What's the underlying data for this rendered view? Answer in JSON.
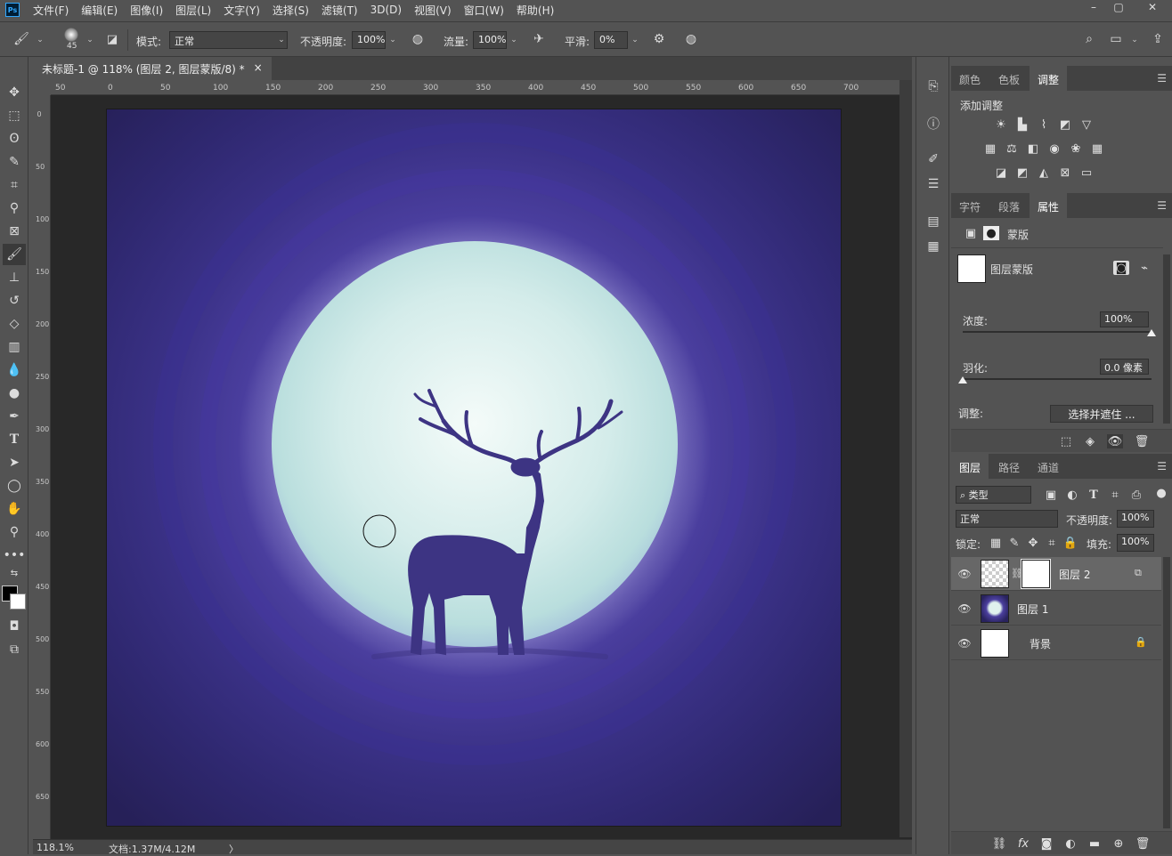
{
  "app": {
    "logo": "Ps"
  },
  "menu": [
    "文件(F)",
    "编辑(E)",
    "图像(I)",
    "图层(L)",
    "文字(Y)",
    "选择(S)",
    "滤镜(T)",
    "3D(D)",
    "视图(V)",
    "窗口(W)",
    "帮助(H)"
  ],
  "window_controls": {
    "minimize": "–",
    "restore": "▢",
    "close": "✕"
  },
  "options": {
    "brush_size": "45",
    "mode_label": "模式:",
    "mode_value": "正常",
    "opacity_label": "不透明度:",
    "opacity_value": "100%",
    "flow_label": "流量:",
    "flow_value": "100%",
    "smoothing_label": "平滑:",
    "smoothing_value": "0%"
  },
  "document": {
    "tab_title": "未标题-1 @ 118% (图层 2, 图层蒙版/8) *",
    "tab_close": "×",
    "ruler_h": [
      "50",
      "0",
      "50",
      "100",
      "150",
      "200",
      "250",
      "300",
      "350",
      "400",
      "450",
      "500",
      "550",
      "600",
      "650",
      "700"
    ],
    "ruler_v": [
      "0",
      "50",
      "100",
      "150",
      "200",
      "250",
      "300",
      "350",
      "400",
      "450",
      "500",
      "550",
      "600",
      "650"
    ]
  },
  "status": {
    "zoom": "118.1%",
    "doc_info": "文档:1.37M/4.12M",
    "arrow": "〉"
  },
  "panels": {
    "color_tabs": [
      "颜色",
      "色板",
      "调整"
    ],
    "color_active": 2,
    "add_adjustment": "添加调整",
    "props_tabs": [
      "字符",
      "段落",
      "属性"
    ],
    "props_active": 2,
    "mask_label": "蒙版",
    "layer_mask_label": "图层蒙版",
    "density_label": "浓度:",
    "density_value": "100%",
    "density": 1.0,
    "feather_label": "羽化:",
    "feather_value": "0.0 像素",
    "feather": 0.0,
    "adjust_label": "调整:",
    "select_mask_button": "选择并遮住 ...",
    "layers_tabs": [
      "图层",
      "路径",
      "通道"
    ],
    "layers_active": 0,
    "filter_kind": "类型",
    "blend_mode": "正常",
    "layer_opacity_label": "不透明度:",
    "layer_opacity_value": "100%",
    "lock_label": "锁定:",
    "fill_label": "填充:",
    "fill_value": "100%",
    "layers": [
      {
        "name": "图层 2",
        "selected": true
      },
      {
        "name": "图层 1",
        "selected": false
      },
      {
        "name": "背景",
        "selected": false
      }
    ]
  },
  "colors": {
    "ui_bg": "#535353",
    "canvas_dark": "#2b2763",
    "moon": "#dff2ef",
    "accent": "#31a8ff"
  }
}
